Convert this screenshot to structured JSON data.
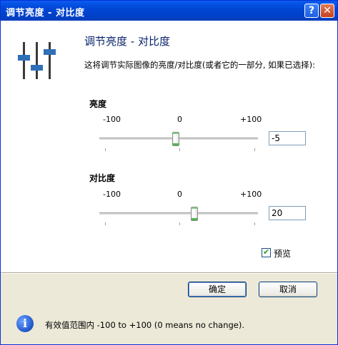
{
  "window": {
    "title": "调节亮度  -  对比度"
  },
  "titlebar": {
    "help_glyph": "?",
    "close_glyph": "✕"
  },
  "header": {
    "heading": "调节亮度 - 对比度",
    "description": "这将调节实际图像的亮度/对比度(或者它的一部分, 如果已选择):"
  },
  "brightness": {
    "label": "亮度",
    "min_label": "-100",
    "mid_label": "0",
    "max_label": "+100",
    "min": -100,
    "max": 100,
    "value": "-5"
  },
  "contrast": {
    "label": "对比度",
    "min_label": "-100",
    "mid_label": "0",
    "max_label": "+100",
    "min": -100,
    "max": 100,
    "value": "20"
  },
  "preview": {
    "label": "预览",
    "checked": true
  },
  "buttons": {
    "ok": "确定",
    "cancel": "取消"
  },
  "info": {
    "text": "有效值范围内 -100 to +100 (0 means no change)."
  },
  "icons": {
    "logo": "sliders-icon",
    "info": "info-icon"
  },
  "colors": {
    "title_bar": "#0046d5",
    "heading": "#0a246a",
    "thumb_accent": "#4cb84c"
  }
}
